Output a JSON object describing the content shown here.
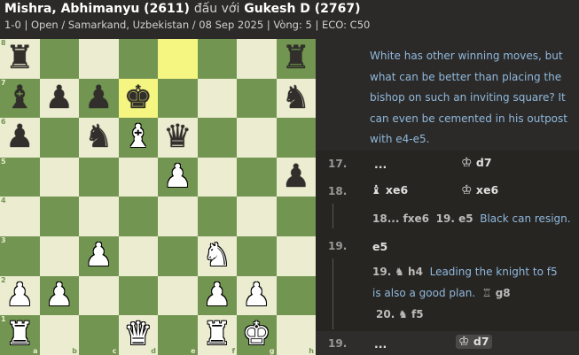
{
  "header": {
    "white_player": "Mishra, Abhimanyu (2611)",
    "versus": "đấu với",
    "black_player": "Gukesh D (2767)",
    "info": "1-0 | Open / Samarkand, Uzbekistan / 08 Sep 2025 | Vòng: 5 | ECO: C50"
  },
  "board": {
    "ranks": [
      "8",
      "7",
      "6",
      "5",
      "4",
      "3",
      "2",
      "1"
    ],
    "files": [
      "a",
      "b",
      "c",
      "d",
      "e",
      "f",
      "g",
      "h"
    ],
    "rows": [
      [
        "bR",
        "",
        "",
        "",
        "",
        "",
        "",
        "bR"
      ],
      [
        "bB",
        "bP",
        "bP",
        "bK",
        "",
        "",
        "",
        "bN"
      ],
      [
        "bP",
        "",
        "bN",
        "wB",
        "bQ",
        "",
        "",
        ""
      ],
      [
        "",
        "",
        "",
        "",
        "wP",
        "",
        "",
        "bP"
      ],
      [
        "",
        "",
        "",
        "",
        "",
        "",
        "",
        ""
      ],
      [
        "",
        "",
        "wP",
        "",
        "",
        "wN",
        "",
        ""
      ],
      [
        "wP",
        "wP",
        "",
        "",
        "",
        "wP",
        "wP",
        ""
      ],
      [
        "wR",
        "",
        "",
        "wQ",
        "",
        "wR",
        "wK",
        ""
      ]
    ],
    "highlighted": [
      "e8",
      "d7"
    ],
    "glyphs": {
      "wK": "♚",
      "wQ": "♛",
      "wR": "♜",
      "wB": "♝",
      "wN": "♞",
      "wP": "♟",
      "bK": "♚",
      "bQ": "♛",
      "bR": "♜",
      "bB": "♝",
      "bN": "♞",
      "bP": "♟"
    }
  },
  "moves": {
    "comment_top": "White has other winning moves, but what can be better than placing the bishop on such an inviting square? It can even be cemented in his outpost with e4-e5.",
    "m17_num": "17.",
    "m17_white": "...",
    "m17_black": "d7",
    "m17_black_icon": "king-icon",
    "m18_num": "18.",
    "m18_white": "xe6",
    "m18_white_icon": "bishop-icon",
    "m18_black": "xe6",
    "m18_black_icon": "king-icon",
    "var1_move_a": "18... fxe6",
    "var1_move_b": "19. e5",
    "var1_comment": "Black can resign.",
    "m19_num": "19.",
    "m19_white": "e5",
    "var2_num": "19.",
    "var2_move": "h4",
    "var2_comment": "Leading the knight to f5 is also a good plan.",
    "var2_reply": "g8",
    "var2_next_num": "20.",
    "var2_next_move": "f5",
    "m19b_num": "19.",
    "m19b_white": "...",
    "m19b_black": "d7",
    "colors": {
      "comment": "#90b8dd",
      "board_light": "#ebecd0",
      "board_dark": "#739552",
      "highlight": "#f5f682"
    }
  }
}
